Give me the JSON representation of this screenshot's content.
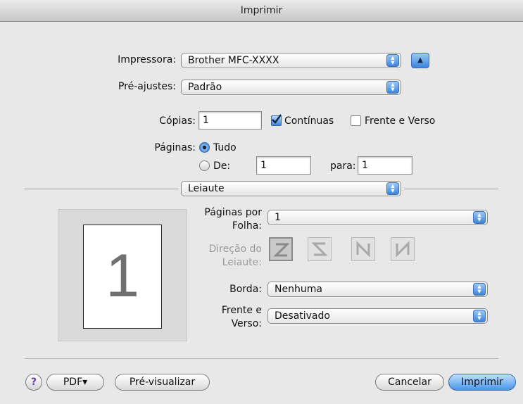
{
  "window": {
    "title": "Imprimir"
  },
  "printer": {
    "label": "Impressora:",
    "value": "Brother MFC-XXXX"
  },
  "presets": {
    "label": "Pré-ajustes:",
    "value": "Padrão"
  },
  "copies": {
    "label": "Cópias:",
    "value": "1",
    "collated_label": "Contínuas",
    "collated_checked": true,
    "duplex_label": "Frente e Verso",
    "duplex_checked": false
  },
  "pages": {
    "label": "Páginas:",
    "all_label": "Tudo",
    "all_selected": true,
    "from_label": "De:",
    "from_value": "1",
    "to_label": "para:",
    "to_value": "1"
  },
  "section": {
    "value": "Leiaute"
  },
  "layout": {
    "preview_number": "1",
    "pages_per_sheet_label_1": "Páginas por",
    "pages_per_sheet_label_2": "Folha:",
    "pages_per_sheet_value": "1",
    "direction_label_1": "Direção do",
    "direction_label_2": "Leiaute:",
    "border_label": "Borda:",
    "border_value": "Nenhuma",
    "duplex_label_1": "Frente e",
    "duplex_label_2": "Verso:",
    "duplex_value": "Desativado"
  },
  "buttons": {
    "help": "?",
    "pdf": "PDF▾",
    "preview": "Pré-visualizar",
    "cancel": "Cancelar",
    "print": "Imprimir"
  },
  "colors": {
    "accent": "#3f86dd",
    "background": "#e8e8e8"
  }
}
